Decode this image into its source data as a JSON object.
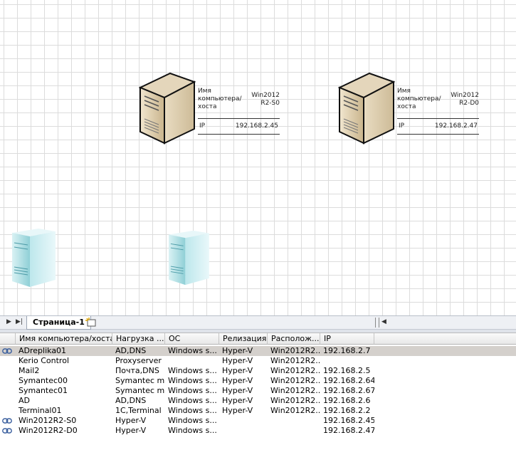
{
  "servers": [
    {
      "label": "Имя компьютера/хоста",
      "name": "Win2012 R2-S0",
      "ip_label": "IP",
      "ip": "192.168.2.45"
    },
    {
      "label": "Имя компьютера/хоста",
      "name": "Win2012 R2-D0",
      "ip_label": "IP",
      "ip": "192.168.2.47"
    }
  ],
  "tabs": {
    "page1": "Страница-1"
  },
  "grid": {
    "columns": [
      "Имя компьютера/хоста",
      "Нагрузка ...",
      "ОС",
      "Релизация",
      "Располож...",
      "IP"
    ],
    "rows": [
      {
        "linked": true,
        "name": "ADreplika01",
        "load": "AD,DNS",
        "os": "Windows s...",
        "rel": "Hyper-V",
        "loc": "Win2012R2...",
        "ip": "192.168.2.7"
      },
      {
        "linked": false,
        "name": "Kerio Control",
        "load": "Proxyserver",
        "os": "",
        "rel": "Hyper-V",
        "loc": "Win2012R2...",
        "ip": ""
      },
      {
        "linked": false,
        "name": "Mail2",
        "load": "Почта,DNS",
        "os": "Windows s...",
        "rel": "Hyper-V",
        "loc": "Win2012R2...",
        "ip": "192.168.2.5"
      },
      {
        "linked": false,
        "name": "Symantec00",
        "load": "Symantec m...",
        "os": "Windows s...",
        "rel": "Hyper-V",
        "loc": "Win2012R2...",
        "ip": "192.168.2.64"
      },
      {
        "linked": false,
        "name": "Symantec01",
        "load": "Symantec m...",
        "os": "Windows s...",
        "rel": "Hyper-V",
        "loc": "Win2012R2...",
        "ip": "192.168.2.67"
      },
      {
        "linked": false,
        "name": "AD",
        "load": "AD,DNS",
        "os": "Windows s...",
        "rel": "Hyper-V",
        "loc": "Win2012R2...",
        "ip": "192.168.2.6"
      },
      {
        "linked": false,
        "name": "Terminal01",
        "load": "1C,Terminal",
        "os": "Windows s...",
        "rel": "Hyper-V",
        "loc": "Win2012R2...",
        "ip": "192.168.2.2"
      },
      {
        "linked": true,
        "name": "Win2012R2-S0",
        "load": "Hyper-V",
        "os": "Windows s...",
        "rel": "",
        "loc": "",
        "ip": "192.168.2.45"
      },
      {
        "linked": true,
        "name": "Win2012R2-D0",
        "load": "Hyper-V",
        "os": "Windows s...",
        "rel": "",
        "loc": "",
        "ip": "192.168.2.47"
      }
    ]
  }
}
